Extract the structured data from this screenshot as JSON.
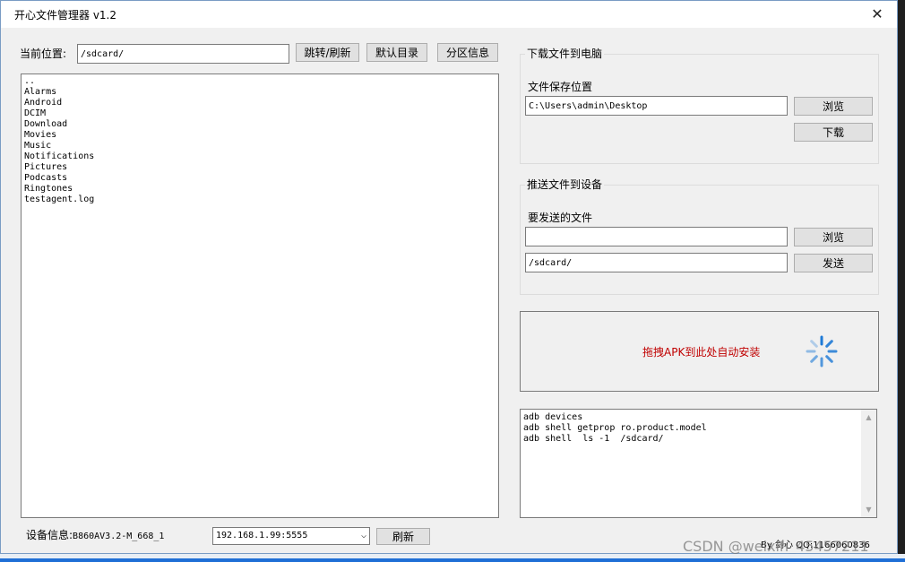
{
  "window": {
    "title": "开心文件管理器  v1.2",
    "close_label": "✕"
  },
  "path_bar": {
    "label": "当前位置:",
    "value": "/sdcard/",
    "buttons": {
      "goto": "跳转/刷新",
      "default": "默认目录",
      "partition": "分区信息"
    }
  },
  "file_list": [
    "..",
    "Alarms",
    "Android",
    "DCIM",
    "Download",
    "Movies",
    "Music",
    "Notifications",
    "Pictures",
    "Podcasts",
    "Ringtones",
    "testagent.log"
  ],
  "download": {
    "group_title": "下载文件到电脑",
    "save_label": "文件保存位置",
    "save_path": "C:\\Users\\admin\\Desktop",
    "browse": "浏览",
    "download": "下载"
  },
  "push": {
    "group_title": "推送文件到设备",
    "file_label": "要发送的文件",
    "file_value": "",
    "browse": "浏览",
    "target_path": "/sdcard/",
    "send": "发送"
  },
  "dropzone": {
    "text": "拖拽APK到此处自动安装",
    "icon": "loading-spinner-icon"
  },
  "log": [
    "adb devices",
    "adb shell getprop ro.product.model",
    "adb shell  ls -1  /sdcard/"
  ],
  "footer": {
    "device_label": "设备信息:",
    "device_value": "B860AV3.2-M_668_1",
    "address": "192.168.1.99:5555",
    "refresh": "刷新",
    "author": "By 剑心   QQ:1166060836"
  },
  "watermark": "CSDN @weixin_45457211",
  "colors": {
    "accent_red": "#c00000",
    "spinner_blue": "#1e7ad6"
  }
}
